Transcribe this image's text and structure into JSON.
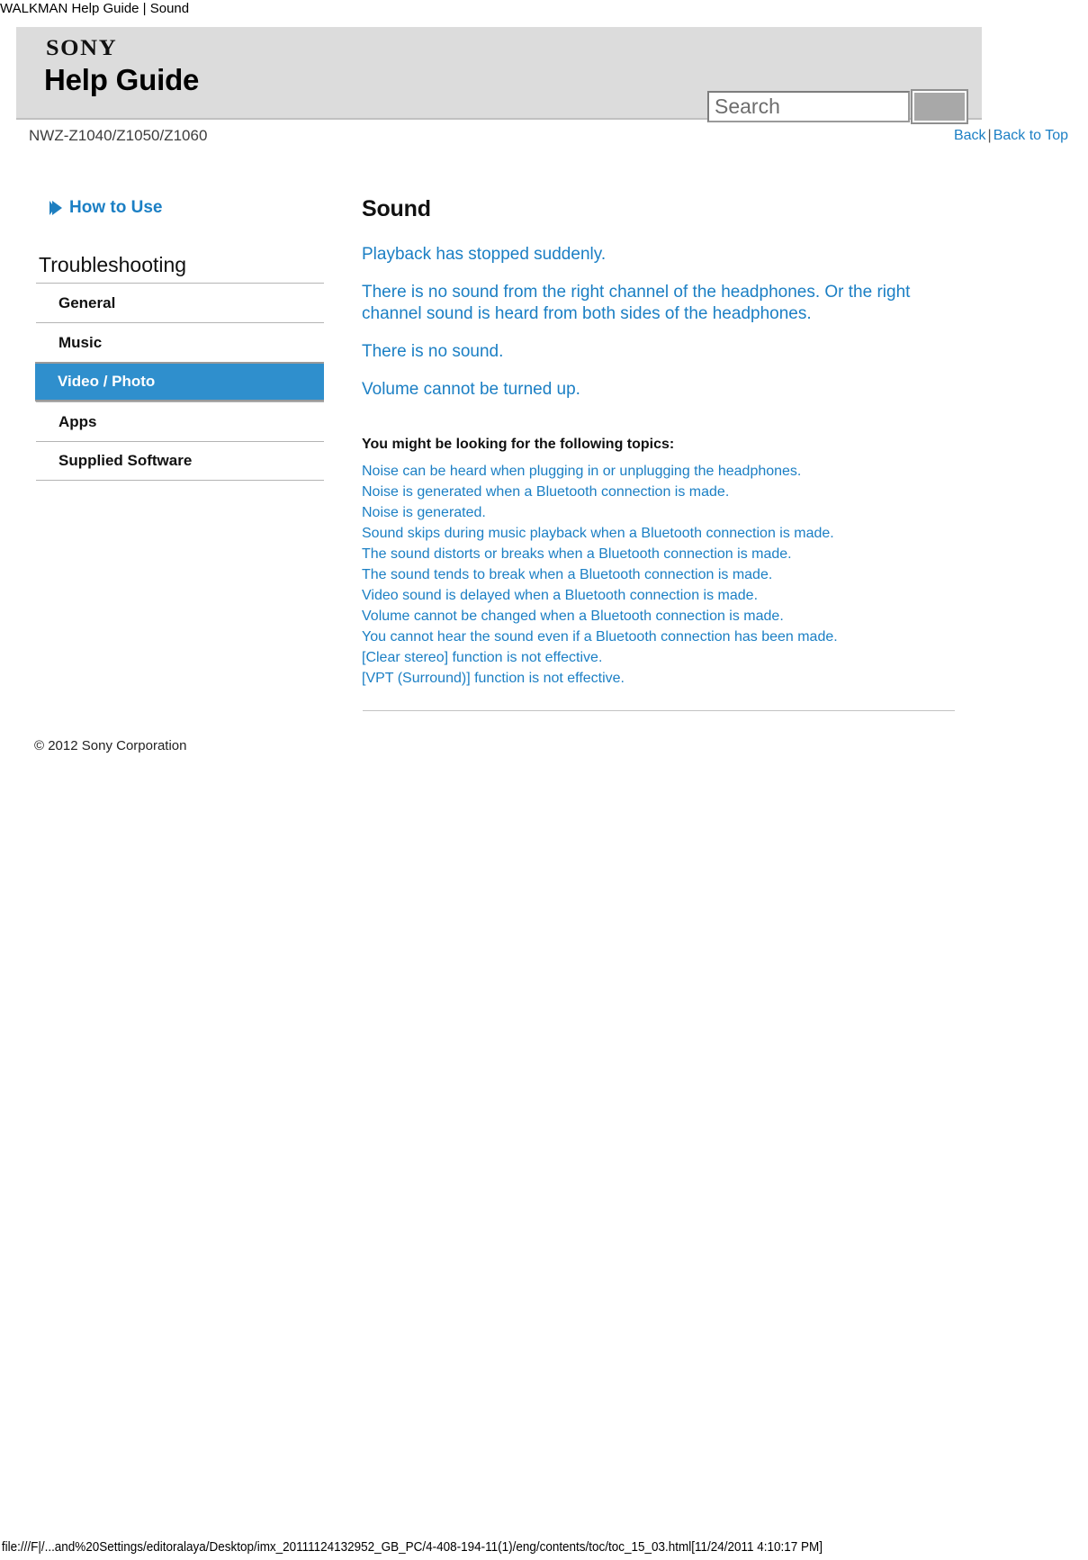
{
  "browser": {
    "document_title": "WALKMAN Help Guide | Sound",
    "status_url": "file:///F|/...and%20Settings/editoralaya/Desktop/imx_20111124132952_GB_PC/4-408-194-11(1)/eng/contents/toc/toc_15_03.html[11/24/2011 4:10:17 PM]"
  },
  "banner": {
    "brand": "SONY",
    "title": "Help Guide"
  },
  "search": {
    "placeholder": "Search",
    "value": "",
    "button_label": ""
  },
  "subheader": {
    "model": "NWZ-Z1040/Z1050/Z1060",
    "back_label": "Back",
    "separator": "|",
    "back_to_top_label": "Back to Top"
  },
  "sidebar": {
    "how_to_use_label": "How to Use",
    "section_title": "Troubleshooting",
    "items": [
      {
        "label": "General",
        "active": false
      },
      {
        "label": "Music",
        "active": false
      },
      {
        "label": "Video / Photo",
        "active": true
      },
      {
        "label": "Apps",
        "active": false
      },
      {
        "label": "Supplied Software",
        "active": false
      }
    ]
  },
  "main": {
    "heading": "Sound",
    "topics": [
      "Playback has stopped suddenly.",
      "There is no sound from the right channel of the headphones. Or the right channel sound is heard from both sides of the headphones.",
      "There is no sound.",
      "Volume cannot be turned up."
    ],
    "related_heading": "You might be looking for the following topics:",
    "related_links": [
      "Noise can be heard when plugging in or unplugging the headphones.",
      "Noise is generated when a Bluetooth connection is made.",
      "Noise is generated.",
      "Sound skips during music playback when a Bluetooth connection is made.",
      "The sound distorts or breaks when a Bluetooth connection is made.",
      "The sound tends to break when a Bluetooth connection is made.",
      "Video sound is delayed when a Bluetooth connection is made.",
      "Volume cannot be changed when a Bluetooth connection is made.",
      "You cannot hear the sound even if a Bluetooth connection has been made.",
      "[Clear stereo] function is not effective.",
      "[VPT (Surround)] function is not effective."
    ]
  },
  "footer": {
    "copyright": "© 2012 Sony Corporation"
  },
  "colors": {
    "link": "#1b7fc4",
    "active_item_bg": "#2f8fcd",
    "banner_bg": "#dcdcdc"
  }
}
